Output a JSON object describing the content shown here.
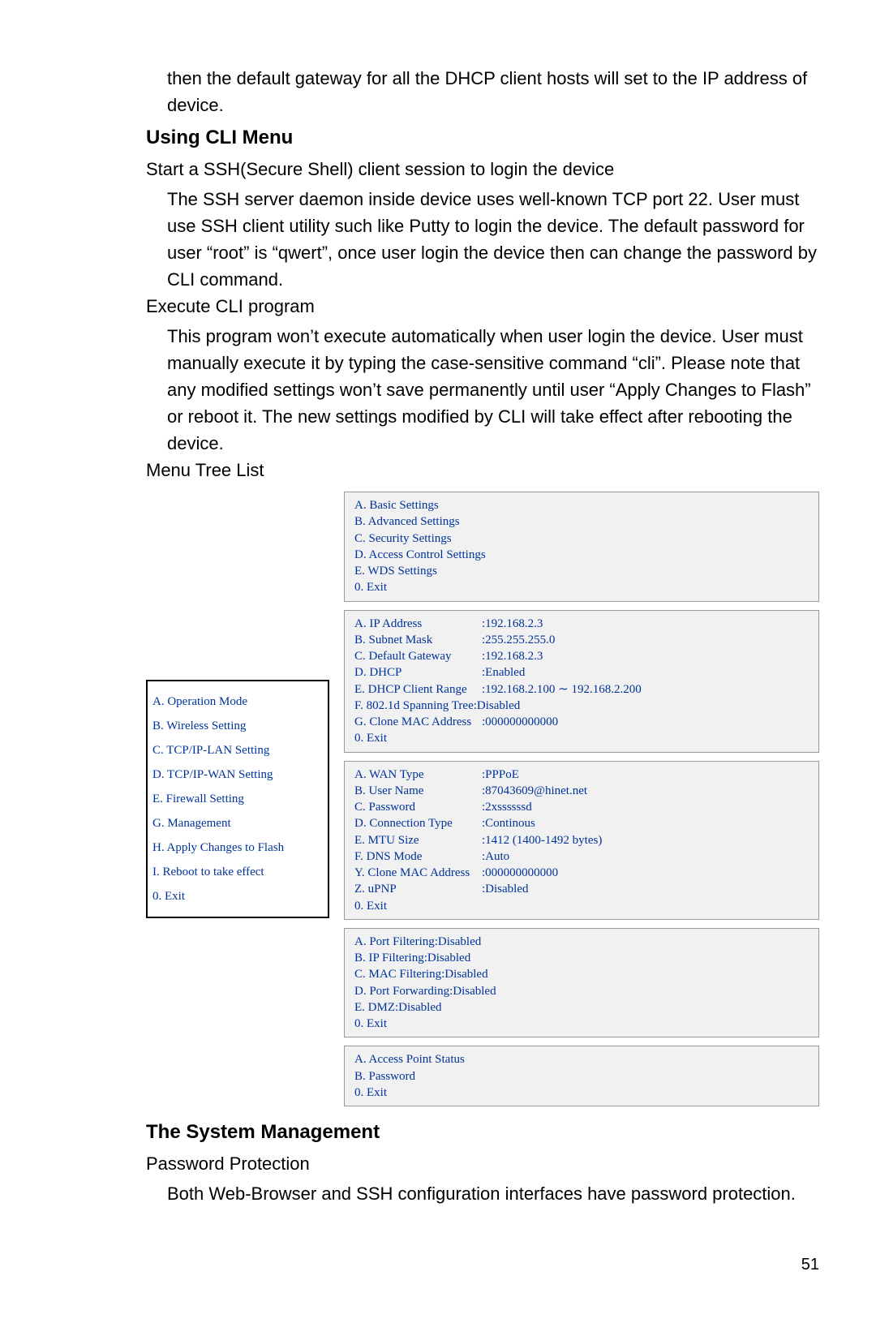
{
  "intro": "then the default gateway for all the DHCP client hosts will set to the IP address of device.",
  "section1_title": "Using CLI Menu",
  "section1": {
    "p1_head": "Start a SSH(Secure Shell) client session to login the device",
    "p1_body": "The SSH server daemon inside device uses well-known TCP port 22. User must use SSH client utility such like Putty to login the device. The default password for user “root” is “qwert”, once user login the device then can change the password by CLI command.",
    "p2_head": "Execute CLI program",
    "p2_body": "This program won’t execute automatically when user login the device. User must manually execute it by typing the case-sensitive command “cli”. Please note that any modified settings won’t save permanently until user “Apply Changes to Flash” or reboot it. The new settings modified by CLI will take effect after rebooting the device.",
    "p3_head": "Menu Tree List"
  },
  "main_menu": [
    "A. Operation Mode",
    "B. Wireless Setting",
    "C. TCP/IP-LAN Setting",
    "D. TCP/IP-WAN Setting",
    "E. Firewall Setting",
    "G. Management",
    "H. Apply Changes to Flash",
    "I. Reboot to take effect",
    "0. Exit"
  ],
  "panels": {
    "wireless": [
      "A. Basic Settings",
      "B. Advanced Settings",
      "C. Security Settings",
      "D. Access Control Settings",
      "E. WDS Settings",
      "0. Exit"
    ],
    "lan": [
      {
        "k": "A. IP Address",
        "v": "192.168.2.3"
      },
      {
        "k": "B. Subnet Mask",
        "v": "255.255.255.0"
      },
      {
        "k": "C. Default Gateway",
        "v": "192.168.2.3"
      },
      {
        "k": "D. DHCP",
        "v": "Enabled"
      },
      {
        "k": "E. DHCP Client Range",
        "v": "192.168.2.100  ∼ 192.168.2.200"
      },
      {
        "k": "F. 802.1d Spanning Tree",
        "v": "Disabled"
      },
      {
        "k": "G. Clone MAC Address",
        "v": "000000000000"
      },
      {
        "k": "0. Exit",
        "v": null
      }
    ],
    "wan": [
      {
        "k": "A. WAN Type",
        "v": "PPPoE"
      },
      {
        "k": "B. User Name",
        "v": "87043609@hinet.net"
      },
      {
        "k": "C. Password",
        "v": "2xssssssd"
      },
      {
        "k": "D. Connection Type",
        "v": "Continous"
      },
      {
        "k": "E. MTU Size",
        "v": "1412 (1400-1492 bytes)"
      },
      {
        "k": "F. DNS Mode",
        "v": "Auto"
      },
      {
        "k": "Y. Clone MAC Address",
        "v": "000000000000"
      },
      {
        "k": "Z. uPNP",
        "v": "Disabled"
      },
      {
        "k": "0. Exit",
        "v": null
      }
    ],
    "firewall": [
      "A. Port Filtering:Disabled",
      "B. IP Filtering:Disabled",
      "C. MAC Filtering:Disabled",
      "D. Port Forwarding:Disabled",
      "E. DMZ:Disabled",
      "0. Exit"
    ],
    "mgmt": [
      "A. Access Point Status",
      "B. Password",
      "0. Exit"
    ]
  },
  "section2_title": "The System Management",
  "section2": {
    "p1_head": "Password Protection",
    "p1_body": "Both Web-Browser and SSH configuration interfaces have password protection."
  },
  "page_number": "51"
}
